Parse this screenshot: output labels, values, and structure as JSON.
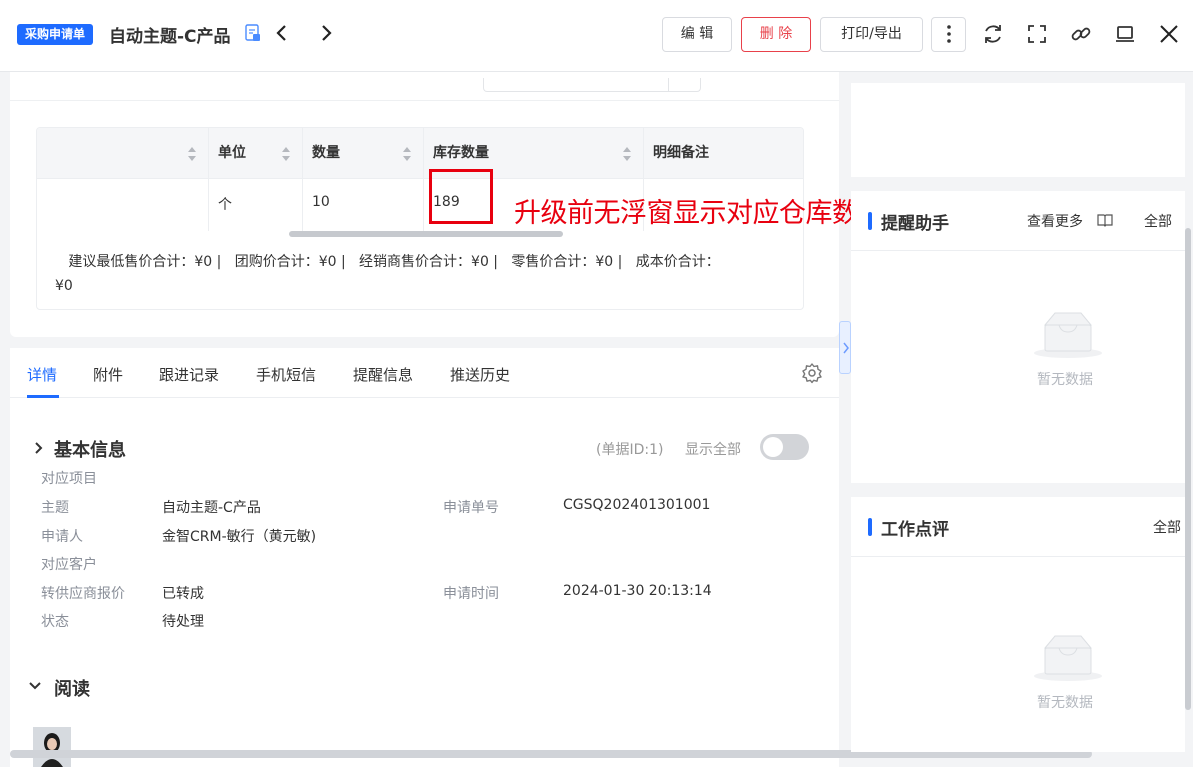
{
  "header": {
    "tag": "采购申请单",
    "title": "自动主题-C产品",
    "buttons": {
      "edit": "编 辑",
      "delete": "删 除",
      "print": "打印/导出"
    },
    "colors": {
      "accent": "#1e6bff",
      "danger": "#e8414a"
    },
    "icons": [
      "doc-icon",
      "chevron-left-icon",
      "chevron-right-icon",
      "more-vertical-icon",
      "refresh-icon",
      "fullscreen-icon",
      "link-icon",
      "laptop-icon",
      "close-icon"
    ]
  },
  "table": {
    "columns": [
      "单位",
      "数量",
      "库存数量",
      "明细备注"
    ],
    "row": {
      "unit": "个",
      "qty": "10",
      "stock": "189",
      "note": ""
    },
    "summary": [
      "建议最低售价合计：¥0 |",
      "团购价合计：¥0 |",
      "经销商售价合计：¥0 |",
      "零售价合计：¥0 |",
      "成本价合计："
    ],
    "summary_tail": "¥0"
  },
  "annotation": "升级前无浮窗显示对应仓库数量",
  "tabs": [
    "详情",
    "附件",
    "跟进记录",
    "手机短信",
    "提醒信息",
    "推送历史"
  ],
  "detail": {
    "section_title": "基本信息",
    "doc_id": "(单据ID:1)",
    "show_all": "显示全部",
    "fields": {
      "project_label": "对应项目",
      "subject_label": "主题",
      "subject_value": "自动主题-C产品",
      "applicant_label": "申请人",
      "applicant_value": "金智CRM-敏行（黄元敏)",
      "customer_label": "对应客户",
      "quote_label": "转供应商报价",
      "quote_value": "已转成",
      "status_label": "状态",
      "status_value": "待处理",
      "number_label": "申请单号",
      "number_value": "CGSQ202401301001",
      "time_label": "申请时间",
      "time_value": "2024-01-30 20:13:14"
    },
    "read_title": "阅读"
  },
  "sidebar": {
    "reminder_title": "提醒助手",
    "view_more": "查看更多",
    "all": "全部",
    "review_title": "工作点评",
    "empty_text": "暂无数据"
  }
}
